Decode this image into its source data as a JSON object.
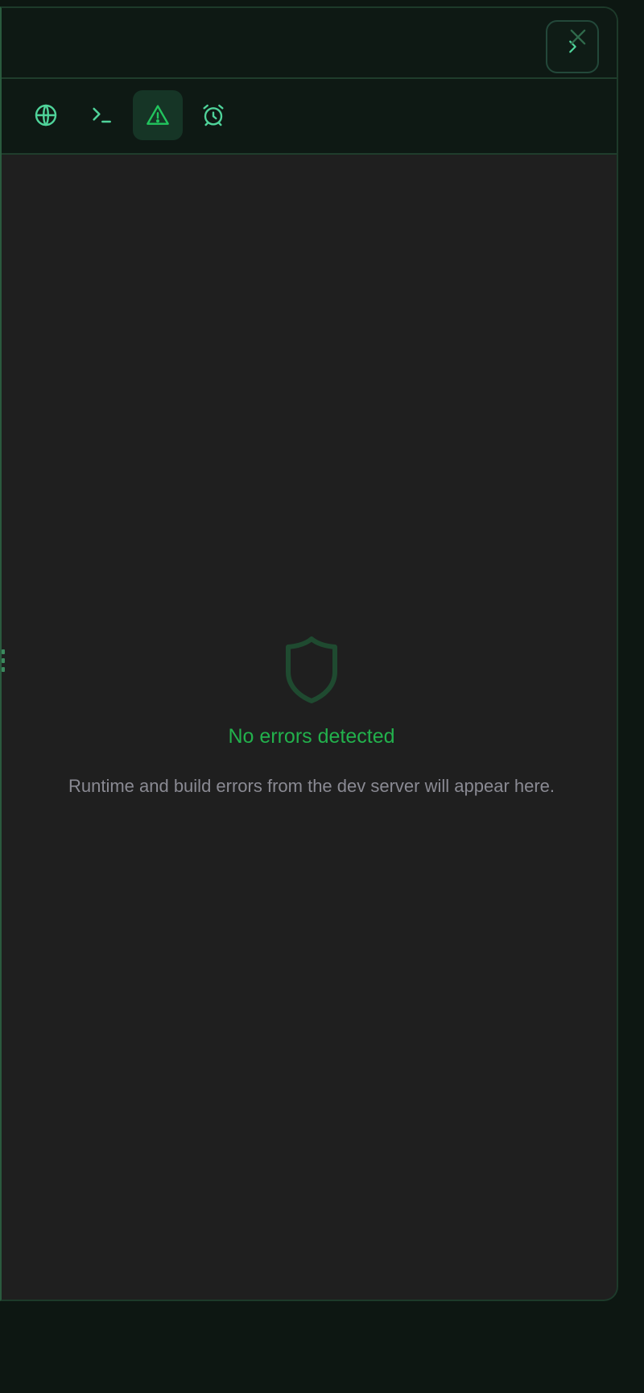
{
  "toolbar": {
    "tools": [
      {
        "id": "preview",
        "icon": "globe-icon",
        "active": false
      },
      {
        "id": "terminal",
        "icon": "terminal-icon",
        "active": false
      },
      {
        "id": "errors",
        "icon": "warning-icon",
        "active": true
      },
      {
        "id": "scheduler",
        "icon": "alarm-clock-icon",
        "active": false
      }
    ]
  },
  "header": {
    "collapse_icon": "chevron-right-icon",
    "close_icon": "close-icon"
  },
  "errors_panel": {
    "icon": "shield-icon",
    "title": "No errors detected",
    "description": "Runtime and build errors from the dev server will appear here."
  },
  "colors": {
    "accent": "#22b14c",
    "icon": "#4fd39a",
    "panel_bg": "#1f1f1f",
    "chrome_bg": "#0e1914"
  }
}
